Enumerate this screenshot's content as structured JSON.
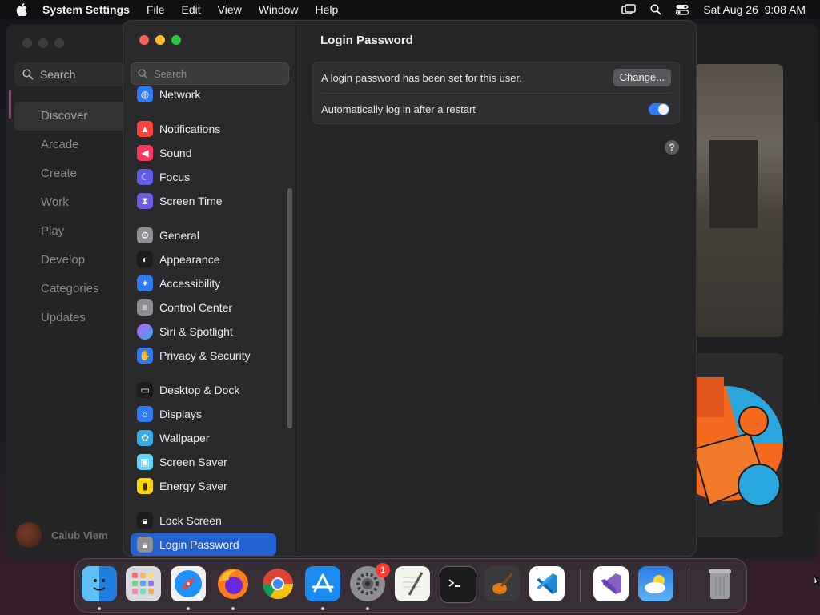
{
  "menubar": {
    "app": "System Settings",
    "items": [
      "File",
      "Edit",
      "View",
      "Window",
      "Help"
    ],
    "datetime": "Sat Aug 26  9:08 AM"
  },
  "background_window": {
    "search_placeholder": "Search",
    "nav": [
      "Discover",
      "Arcade",
      "Create",
      "Work",
      "Play",
      "Develop",
      "Categories",
      "Updates"
    ],
    "selected": "Discover",
    "user": "Calub Viem"
  },
  "settings": {
    "search_placeholder": "Search",
    "sidebar": [
      {
        "label": "Network",
        "icon": "globe-icon",
        "color": "#2f7bf5"
      },
      {
        "label": "Notifications",
        "icon": "bell-icon",
        "color": "#ff453a"
      },
      {
        "label": "Sound",
        "icon": "speaker-icon",
        "color": "#ff375f"
      },
      {
        "label": "Focus",
        "icon": "moon-icon",
        "color": "#5e5ce6"
      },
      {
        "label": "Screen Time",
        "icon": "hourglass-icon",
        "color": "#6e5ce6"
      },
      {
        "label": "General",
        "icon": "gear-icon",
        "color": "#8e8e93"
      },
      {
        "label": "Appearance",
        "icon": "appearance-icon",
        "color": "#1c1c1e"
      },
      {
        "label": "Accessibility",
        "icon": "accessibility-icon",
        "color": "#2f7bf5"
      },
      {
        "label": "Control Center",
        "icon": "control-center-icon",
        "color": "#8e8e93"
      },
      {
        "label": "Siri & Spotlight",
        "icon": "siri-icon",
        "color": "#bf5af2"
      },
      {
        "label": "Privacy & Security",
        "icon": "hand-icon",
        "color": "#2f7bf5"
      },
      {
        "label": "Desktop & Dock",
        "icon": "dock-icon",
        "color": "#1c1c1e"
      },
      {
        "label": "Displays",
        "icon": "sun-icon",
        "color": "#2f7bf5"
      },
      {
        "label": "Wallpaper",
        "icon": "flower-icon",
        "color": "#32ade6"
      },
      {
        "label": "Screen Saver",
        "icon": "screen-saver-icon",
        "color": "#64d2ff"
      },
      {
        "label": "Energy Saver",
        "icon": "battery-icon",
        "color": "#ffd60a"
      },
      {
        "label": "Lock Screen",
        "icon": "lock-icon",
        "color": "#1c1c1e"
      },
      {
        "label": "Login Password",
        "icon": "lock-icon",
        "color": "#8e8e93"
      }
    ],
    "selected": "Login Password",
    "page_title": "Login Password",
    "password_row": "A login password has been set for this user.",
    "change_button": "Change...",
    "autologin_row": "Automatically log in after a restart",
    "autologin_enabled": true,
    "help": "?"
  },
  "dock": {
    "apps": [
      {
        "name": "Finder",
        "icon": "finder-icon",
        "running": true
      },
      {
        "name": "Launchpad",
        "icon": "launchpad-icon",
        "running": false
      },
      {
        "name": "Safari",
        "icon": "safari-icon",
        "running": true
      },
      {
        "name": "Firefox",
        "icon": "firefox-icon",
        "running": true
      },
      {
        "name": "Chrome",
        "icon": "chrome-icon",
        "running": false
      },
      {
        "name": "App Store",
        "icon": "app-store-icon",
        "running": true
      },
      {
        "name": "System Settings",
        "icon": "system-settings-icon",
        "running": true,
        "badge": "1"
      },
      {
        "name": "TextEdit",
        "icon": "textedit-icon",
        "running": false
      },
      {
        "name": "Terminal",
        "icon": "terminal-icon",
        "running": false
      },
      {
        "name": "GarageBand",
        "icon": "garageband-icon",
        "running": false
      },
      {
        "name": "Visual Studio Code",
        "icon": "vscode-icon",
        "running": false
      },
      {
        "name": "Visual Studio",
        "icon": "visual-studio-icon",
        "running": false
      },
      {
        "name": "Weather",
        "icon": "weather-icon",
        "running": false
      },
      {
        "name": "Trash",
        "icon": "trash-icon",
        "running": false
      }
    ]
  }
}
